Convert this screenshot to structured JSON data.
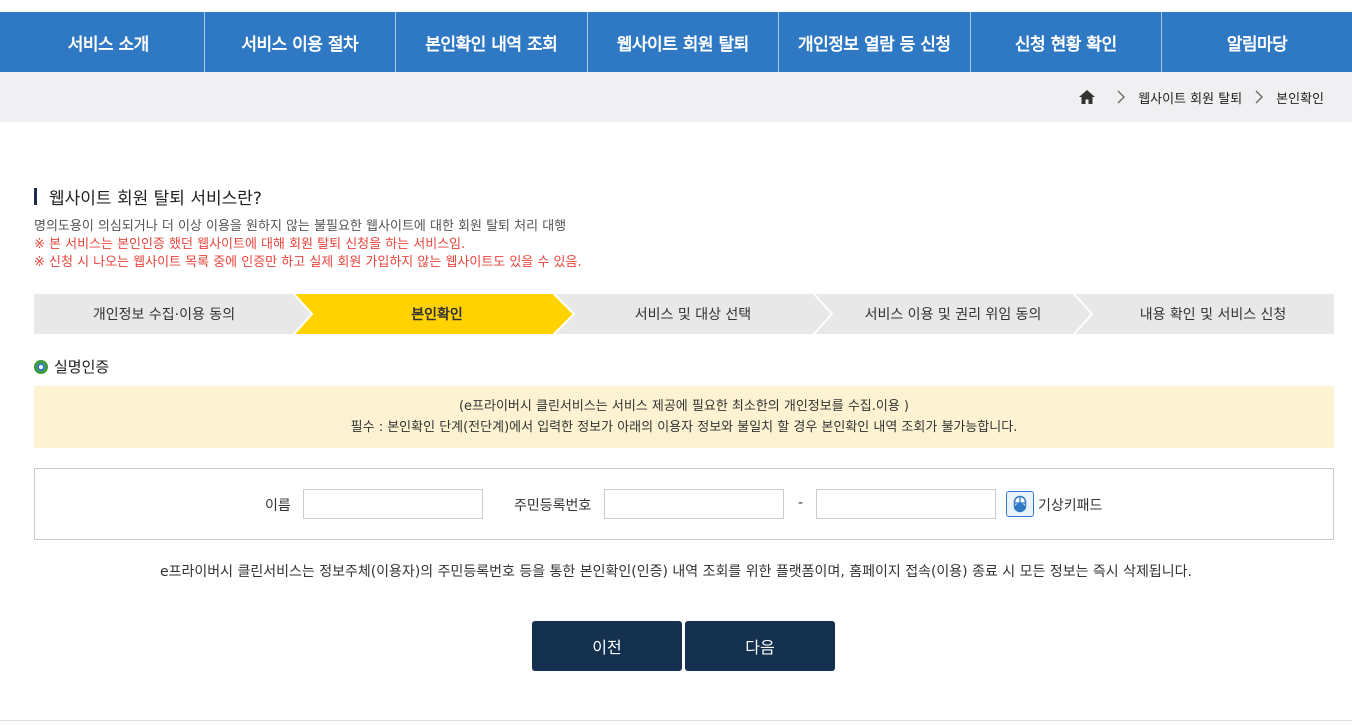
{
  "topnav": {
    "items": [
      "서비스 소개",
      "서비스 이용 절차",
      "본인확인 내역 조회",
      "웹사이트 회원 탈퇴",
      "개인정보 열람 등 신청",
      "신청 현황 확인",
      "알림마당"
    ]
  },
  "breadcrumb": {
    "home_icon": "home-icon",
    "items": [
      "웹사이트 회원 탈퇴",
      "본인확인"
    ]
  },
  "section": {
    "title": "웹사이트 회원 탈퇴 서비스란?",
    "description": "명의도용이 의심되거나 더 이상 이용을 원하지 않는 불필요한 웹사이트에 대한 회원 탈퇴 처리 대행",
    "warnings": [
      "※ 본 서비스는 본인인증 했던 웹사이트에 대해 회원 탈퇴 신청을 하는 서비스임.",
      "※ 신청 시 나오는 웹사이트 목록 중에 인증만 하고 실제 회원 가입하지 않는 웹사이트도 있을 수 있음."
    ]
  },
  "steps": {
    "items": [
      "개인정보 수집·이용 동의",
      "본인확인",
      "서비스 및 대상 선택",
      "서비스 이용 및 권리 위임 동의",
      "내용 확인 및 서비스 신청"
    ],
    "active_index": 1,
    "active_color": "#ffd200",
    "inactive_color": "#e8e8e8"
  },
  "verification": {
    "title": "실명인증",
    "notice_line1": "(e프라이버시 클린서비스는 서비스 제공에 필요한 최소한의 개인정보를 수집.이용 )",
    "notice_line2": "필수 : 본인확인 단계(전단계)에서 입력한 정보가 아래의 이용자 정보와 불일치 할 경우 본인확인 내역 조회가 불가능합니다."
  },
  "form": {
    "name_label": "이름",
    "name_value": "",
    "rrn_label": "주민등록번호",
    "rrn_front_value": "",
    "rrn_back_value": "",
    "dash": "-",
    "keypad_icon": "mouse-icon",
    "keypad_label": "기상키패드"
  },
  "footer_note": "e프라이버시 클린서비스는 정보주체(이용자)의 주민등록번호 등을 통한 본인확인(인증) 내역 조회를 위한 플랫폼이며, 홈페이지 접속(이용) 종료 시 모든 정보는 즉시 삭제됩니다.",
  "buttons": {
    "prev": "이전",
    "next": "다음"
  },
  "colors": {
    "nav_blue": "#2f78c4",
    "button_navy": "#13304f",
    "warning_red": "#e8453c",
    "notice_bg": "#fdf3d2"
  }
}
